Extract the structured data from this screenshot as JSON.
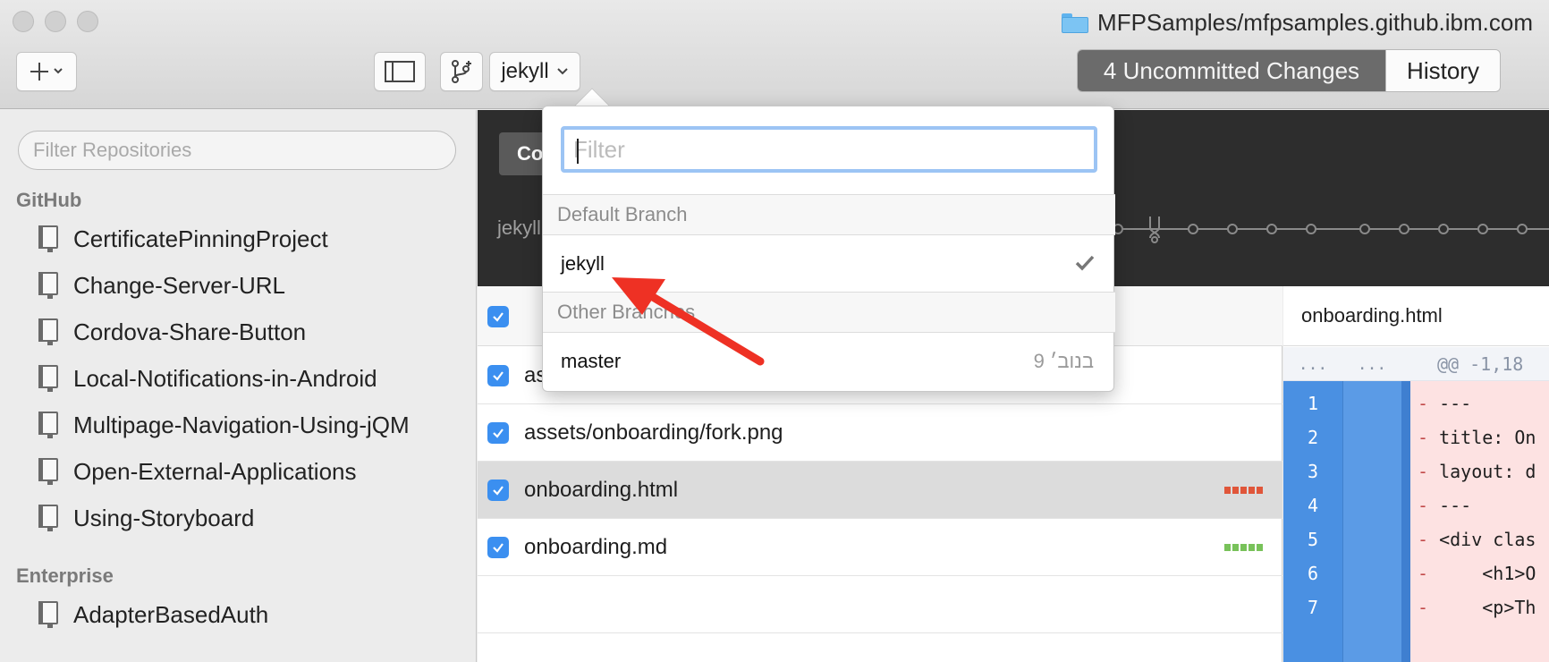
{
  "window": {
    "repo_path": "MFPSamples/mfpsamples.github.ibm.com"
  },
  "toolbar": {
    "current_branch": "jekyll",
    "uncommitted_label": "4 Uncommitted Changes",
    "history_label": "History"
  },
  "sidebar": {
    "filter_placeholder": "Filter Repositories",
    "groups": [
      {
        "name": "GitHub",
        "items": [
          "CertificatePinningProject",
          "Change-Server-URL",
          "Cordova-Share-Button",
          "Local-Notifications-in-Android",
          "Multipage-Navigation-Using-jQM",
          "Open-External-Applications",
          "Using-Storyboard"
        ]
      },
      {
        "name": "Enterprise",
        "items": [
          "AdapterBasedAuth"
        ]
      }
    ]
  },
  "main": {
    "commit_label": "Co",
    "dark_branch_label": "jekyll"
  },
  "files": [
    {
      "name": "as",
      "checked": true
    },
    {
      "name": "assets/onboarding/fork.png",
      "checked": true
    },
    {
      "name": "onboarding.html",
      "checked": true,
      "selected": true
    },
    {
      "name": "onboarding.md",
      "checked": true
    }
  ],
  "diff": {
    "file_name": "onboarding.html",
    "hunk_dots_a": "...",
    "hunk_dots_b": "...",
    "hunk": "@@ -1,18",
    "lines": [
      {
        "num": "1",
        "sign": "-",
        "text": "---"
      },
      {
        "num": "2",
        "sign": "-",
        "text": "title: On"
      },
      {
        "num": "3",
        "sign": "-",
        "text": "layout: d"
      },
      {
        "num": "4",
        "sign": "-",
        "text": "---"
      },
      {
        "num": "5",
        "sign": "-",
        "text": "<div clas"
      },
      {
        "num": "6",
        "sign": "-",
        "text": "    <h1>O"
      },
      {
        "num": "7",
        "sign": "-",
        "text": "    <p>Th"
      }
    ]
  },
  "branch_popover": {
    "filter_placeholder": "Filter",
    "default_section": "Default Branch",
    "default_branch": "jekyll",
    "other_section": "Other Branches",
    "other_branches": [
      {
        "name": "master",
        "date": "9 בנוב׳"
      }
    ]
  },
  "colors": {
    "accent": "#3b8ff0",
    "deletion": "#e0563a",
    "addition": "#78c25a",
    "arrow": "#ee3124"
  }
}
